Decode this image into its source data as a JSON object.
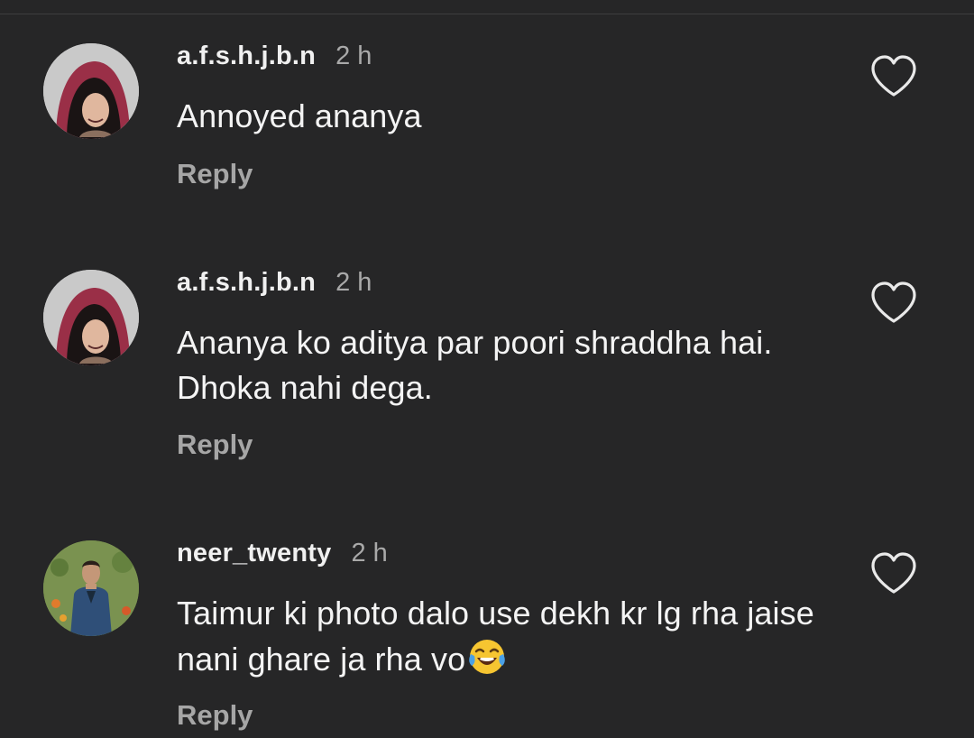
{
  "comments": [
    {
      "username": "a.f.s.h.j.b.n",
      "time": "2 h",
      "text": "Annoyed ananya",
      "reply_label": "Reply",
      "avatar": "profile-photo-woman-red-hood",
      "like_icon": "heart-outline-icon"
    },
    {
      "username": "a.f.s.h.j.b.n",
      "time": "2 h",
      "text": "Ananya ko aditya par poori shraddha hai. Dhoka nahi dega.",
      "reply_label": "Reply",
      "avatar": "profile-photo-woman-red-hood",
      "like_icon": "heart-outline-icon"
    },
    {
      "username": "neer_twenty",
      "time": "2 h",
      "text": "Taimur ki photo dalo use dekh kr lg rha jaise nani ghare ja rha vo",
      "emoji": "face-with-tears-of-joy-emoji",
      "reply_label": "Reply",
      "avatar": "profile-photo-man-blue-jacket",
      "like_icon": "heart-outline-icon"
    }
  ],
  "colors": {
    "background": "#262627",
    "text": "#f4f4f4",
    "secondary_text": "#a9a9a9"
  }
}
